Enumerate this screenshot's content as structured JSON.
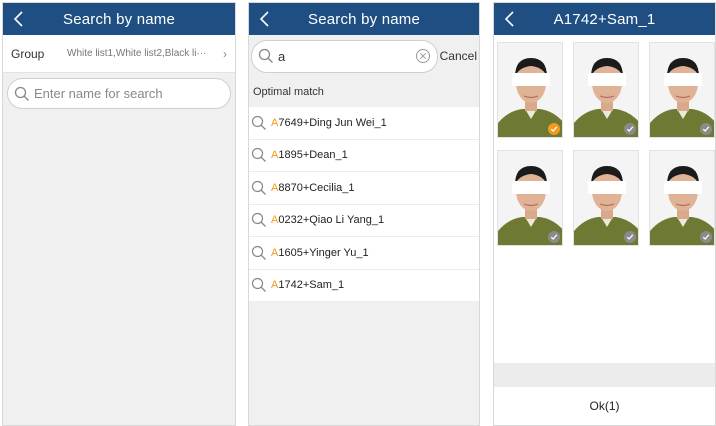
{
  "panel1": {
    "title": "Search by name",
    "group_label": "Group",
    "group_value": "White list1,White list2,Black li···",
    "group_chevron": "›",
    "search_placeholder": "Enter name for search"
  },
  "panel2": {
    "title": "Search by name",
    "search_value": "a",
    "cancel_label": "Cancel",
    "section_title": "Optimal match",
    "results": [
      {
        "highlight": "A",
        "rest": "7649+Ding Jun Wei_1"
      },
      {
        "highlight": "A",
        "rest": "1895+Dean_1"
      },
      {
        "highlight": "A",
        "rest": "8870+Cecilia_1"
      },
      {
        "highlight": "A",
        "rest": "0232+Qiao Li Yang_1"
      },
      {
        "highlight": "A",
        "rest": "1605+Yinger Yu_1"
      },
      {
        "highlight": "A",
        "rest": "1742+Sam_1"
      }
    ]
  },
  "panel3": {
    "title": "A1742+Sam_1",
    "photos": [
      {
        "selected": true
      },
      {
        "selected": false
      },
      {
        "selected": false
      },
      {
        "selected": false
      },
      {
        "selected": false
      },
      {
        "selected": false
      }
    ],
    "ok_label": "Ok(1)"
  },
  "colors": {
    "navbar": "#1f4f82",
    "highlight": "#f39a1e",
    "check_selected": "#f39a1e",
    "check_unselected": "#8a8a8a"
  },
  "icons": {
    "back": "chevron-left-icon",
    "search": "magnifier-icon",
    "clear": "circle-x-icon",
    "check": "checkmark-icon"
  }
}
